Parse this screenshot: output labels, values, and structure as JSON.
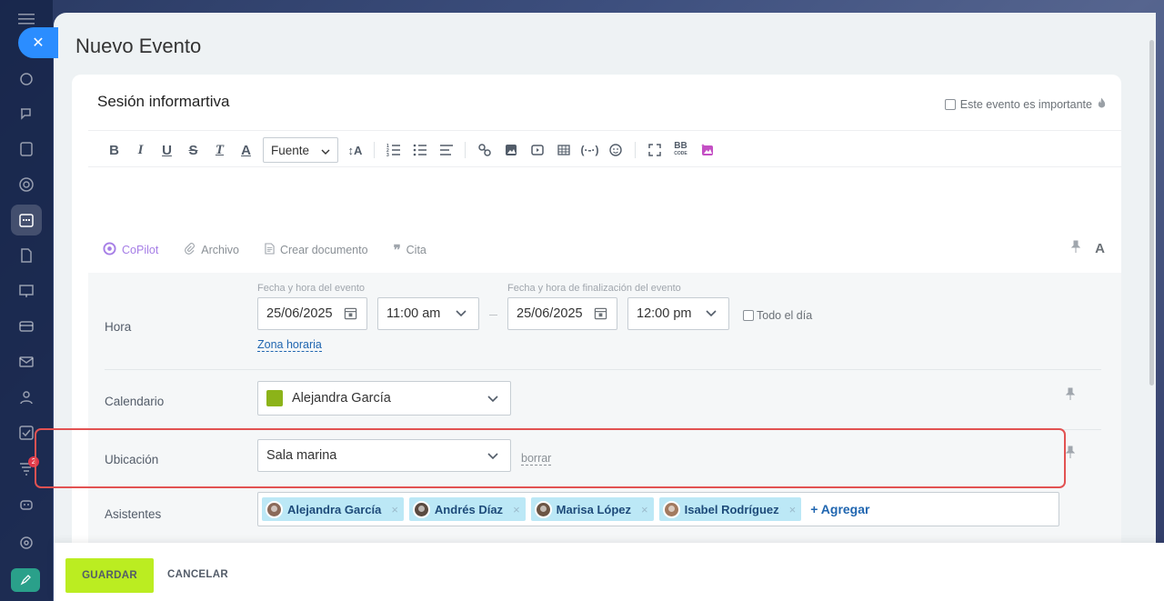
{
  "panel": {
    "title": "Nuevo Evento"
  },
  "event": {
    "name": "Sesión informartiva",
    "important_label": "Este evento es importante"
  },
  "toolbar": {
    "font_select": "Fuente",
    "icons": [
      "bold-icon",
      "italic-icon",
      "underline-icon",
      "strikethrough-icon",
      "clear-format-icon",
      "text-color-icon",
      "font-size-icon",
      "numbered-list-icon",
      "bullet-list-icon",
      "align-icon",
      "link-icon",
      "image-icon",
      "video-icon",
      "table-icon",
      "code-icon",
      "emoji-icon",
      "fullscreen-icon",
      "bbcode-icon",
      "ai-image-icon"
    ]
  },
  "attach": {
    "copilot": "CoPilot",
    "file": "Archivo",
    "create_doc": "Crear documento",
    "quote": "Cita"
  },
  "time": {
    "label": "Hora",
    "start_caption": "Fecha y hora del evento",
    "end_caption": "Fecha y hora de finalización del evento",
    "start_date": "25/06/2025",
    "start_time": "11:00 am",
    "end_date": "25/06/2025",
    "end_time": "12:00 pm",
    "all_day": "Todo el día",
    "timezone": "Zona horaria"
  },
  "calendar": {
    "label": "Calendario",
    "value": "Alejandra García",
    "color": "#8cb319"
  },
  "location": {
    "label": "Ubicación",
    "value": "Sala marina",
    "clear": "borrar"
  },
  "attendees": {
    "label": "Asistentes",
    "people": [
      {
        "name": "Alejandra García",
        "avatar_color": "#8a6a5a"
      },
      {
        "name": "Andrés Díaz",
        "avatar_color": "#5a4a40"
      },
      {
        "name": "Marisa López",
        "avatar_color": "#6b5545"
      },
      {
        "name": "Isabel Rodríguez",
        "avatar_color": "#a27a60"
      }
    ],
    "add": "+ Agregar"
  },
  "footer": {
    "save": "GUARDAR",
    "cancel": "CANCELAR"
  },
  "sidebar": {
    "badge_count": "2"
  }
}
